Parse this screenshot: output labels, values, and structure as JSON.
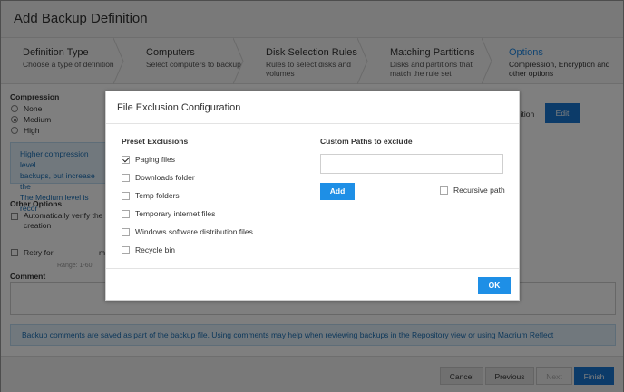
{
  "window": {
    "title": "Add Backup Definition"
  },
  "steps": [
    {
      "title": "Definition Type",
      "subtitle": "Choose a type of definition"
    },
    {
      "title": "Computers",
      "subtitle": "Select computers to backup"
    },
    {
      "title": "Disk Selection Rules",
      "subtitle_l1": "Rules to select disks and",
      "subtitle_l2": "volumes"
    },
    {
      "title": "Matching Partitions",
      "subtitle_l1": "Disks and partitions that",
      "subtitle_l2": "match the rule set"
    },
    {
      "title": "Options",
      "subtitle_l1": "Compression, Encryption and",
      "subtitle_l2": "other options"
    }
  ],
  "compression": {
    "label": "Compression",
    "options": [
      "None",
      "Medium",
      "High"
    ],
    "selected": "Medium"
  },
  "info_box": {
    "line1": "Higher compression level",
    "line2": "backups, but increase the",
    "line3": "The Medium level is recor"
  },
  "encryption": {
    "trailing_text": "inition",
    "edit_label": "Edit"
  },
  "other_options": {
    "label": "Other Options",
    "verify_l1": "Automatically verify the",
    "verify_l2": "creation",
    "retry_label": "Retry for",
    "retry_unit": "m",
    "range_text": "Range: 1-60"
  },
  "comment": {
    "label": "Comment",
    "note": "Backup comments are saved as part of the backup file. Using comments may help when reviewing backups in the Repository view or using Macrium Reflect"
  },
  "footer": {
    "cancel": "Cancel",
    "previous": "Previous",
    "next": "Next",
    "finish": "Finish"
  },
  "modal": {
    "title": "File Exclusion Configuration",
    "preset_label": "Preset Exclusions",
    "presets": [
      {
        "label": "Paging files",
        "checked": true
      },
      {
        "label": "Downloads folder",
        "checked": false
      },
      {
        "label": "Temp folders",
        "checked": false
      },
      {
        "label": "Temporary internet files",
        "checked": false
      },
      {
        "label": "Windows software distribution files",
        "checked": false
      },
      {
        "label": "Recycle bin",
        "checked": false
      }
    ],
    "custom_label": "Custom Paths to exclude",
    "custom_value": "",
    "add_label": "Add",
    "recursive_label": "Recursive path",
    "recursive_checked": false,
    "ok_label": "OK"
  },
  "colors": {
    "accent": "#1e8fe6",
    "header_bg": "#f2f2f2",
    "info_bg": "#e3f1fb",
    "info_text": "#1a6fb5",
    "overlay": "rgba(0,0,0,0.5)"
  }
}
